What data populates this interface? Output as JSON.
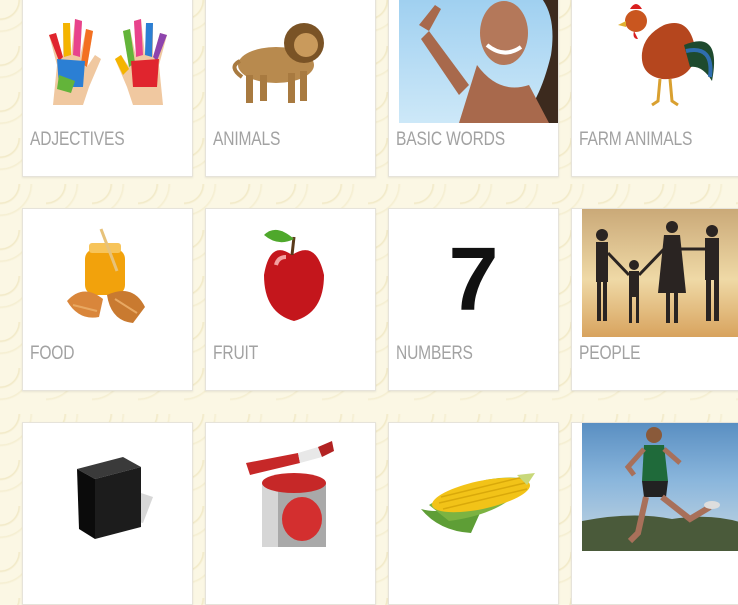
{
  "categories": [
    {
      "label": "ADJECTIVES"
    },
    {
      "label": "ANIMALS"
    },
    {
      "label": "BASIC WORDS"
    },
    {
      "label": "FARM ANIMALS"
    },
    {
      "label": "FOOD"
    },
    {
      "label": "FRUIT"
    },
    {
      "label": "NUMBERS",
      "glyph": "7"
    },
    {
      "label": "PEOPLE"
    },
    {
      "label": ""
    },
    {
      "label": ""
    },
    {
      "label": ""
    },
    {
      "label": ""
    }
  ]
}
